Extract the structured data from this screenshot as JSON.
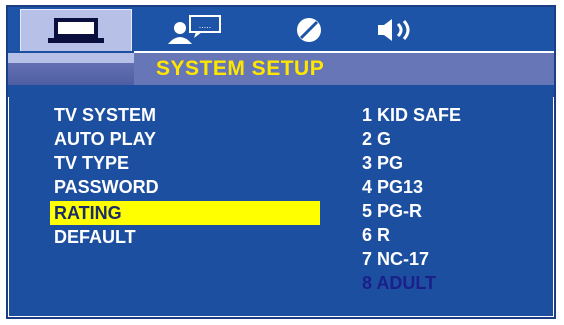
{
  "title": "SYSTEM SETUP",
  "tabs": [
    {
      "icon": "monitor-icon"
    },
    {
      "icon": "person-speech-icon"
    },
    {
      "icon": "disc-icon"
    },
    {
      "icon": "speaker-icon"
    }
  ],
  "menu": [
    "TV SYSTEM",
    "AUTO PLAY",
    "TV TYPE",
    "PASSWORD",
    "RATING",
    "DEFAULT"
  ],
  "options": [
    "1 KID SAFE",
    "2 G",
    "3 PG",
    "4 PG13",
    "5 PG-R",
    "6 R",
    "7 NC-17",
    "8 ADULT"
  ],
  "colors": {
    "accent": "#ffe600",
    "selection": "#ffff00",
    "background": "#1d4fa0"
  }
}
